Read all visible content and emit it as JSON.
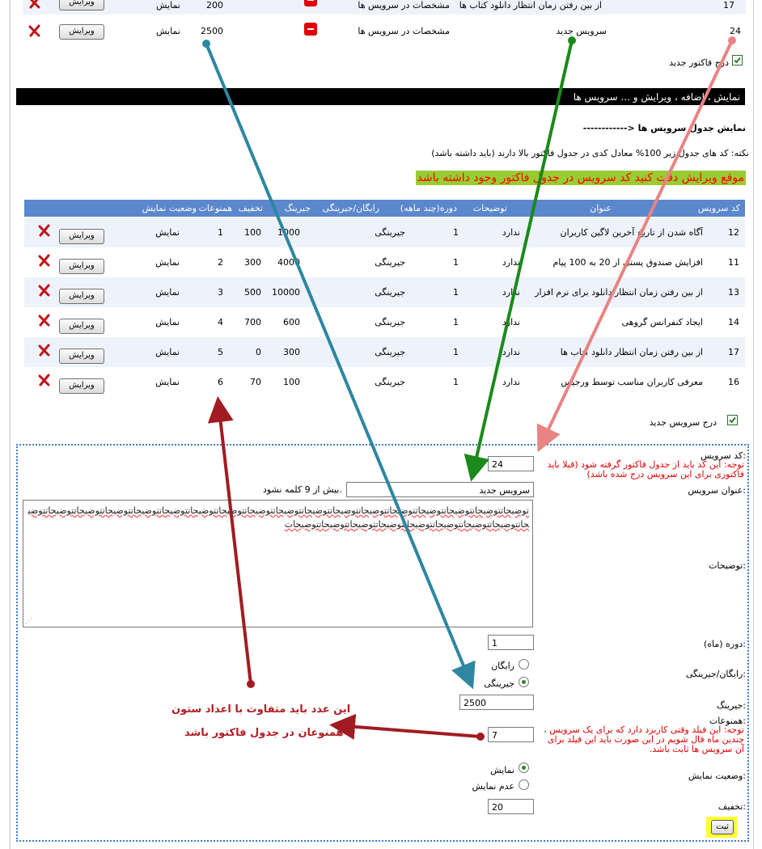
{
  "top_rows": [
    {
      "id": "17",
      "title": "از بین رفتن زمان انتظار دانلود کتاب ها",
      "spec": "مشخصات در سرویس ها",
      "price": "200",
      "status": "نمایش",
      "edit": "ویرایش"
    },
    {
      "id": "24",
      "title": "سرویس جدید",
      "spec": "مشخصات در سرویس ها",
      "price": "2500",
      "status": "نمایش",
      "edit": "ویرایش"
    }
  ],
  "insert_invoice_label": "درج فاکتور جدید",
  "section_bar_title": "نمایش ، اضافه ، ویرایش و ... سرویس ها",
  "services_table_link": "------------> نمایش جدول سرویس ها",
  "note": "نکته: کد های جدول زیر 100% معادل کدی در جدول فاکتور بالا دارند (باید داشته باشد)",
  "highlight_warning": "موقع ویرایش دقت کنید کد سرویس در جدول فاکتور وجود داشته باشد",
  "table": {
    "headers": [
      "کد سرویس",
      "عنوان",
      "توضیحات",
      "دوره(چند ماهه)",
      "رایگان/جیرینگی",
      "جیرینگ",
      "تخفیف",
      "همنوعات",
      "وضعیت نمایش"
    ],
    "rows": [
      {
        "code": "12",
        "title": "آگاه شدن از تاریخ آخرین لاگین کاربران",
        "desc": "ندارد",
        "period": "1",
        "type": "جیرینگی",
        "price": "1000",
        "discount": "100",
        "siblings": "1",
        "status": "نمایش",
        "edit": "ویرایش"
      },
      {
        "code": "11",
        "title": "افزایش صندوق پستی از 20 به 100 پیام",
        "desc": "ندارد",
        "period": "1",
        "type": "جیرینگی",
        "price": "4000",
        "discount": "300",
        "siblings": "2",
        "status": "نمایش",
        "edit": "ویرایش"
      },
      {
        "code": "13",
        "title": "از بین رفتن زمان انتظار دانلود برای نرم افزار",
        "desc": "ندارد",
        "period": "1",
        "type": "جیرینگی",
        "price": "10000",
        "discount": "500",
        "siblings": "3",
        "status": "نمایش",
        "edit": "ویرایش"
      },
      {
        "code": "14",
        "title": "ایجاد کنفرانس گروهی",
        "desc": "ندارد",
        "period": "1",
        "type": "جیرینگی",
        "price": "600",
        "discount": "700",
        "siblings": "4",
        "status": "نمایش",
        "edit": "ویرایش"
      },
      {
        "code": "17",
        "title": "از بین رفتن زمان انتظار دانلود کتاب ها",
        "desc": "ندارد",
        "period": "1",
        "type": "جیرینگی",
        "price": "300",
        "discount": "0",
        "siblings": "5",
        "status": "نمایش",
        "edit": "ویرایش"
      },
      {
        "code": "16",
        "title": "معرفی کاربران مناسب توسط ورجیس",
        "desc": "ندارد",
        "period": "1",
        "type": "جیرینگی",
        "price": "100",
        "discount": "70",
        "siblings": "6",
        "status": "نمایش",
        "edit": "ویرایش"
      }
    ]
  },
  "insert_service_label": "درج سرویس جدید",
  "form": {
    "code_label": "کد سرویس:",
    "code_note": "توجه: این کد باید از جدول فاکتور گرفته شود (قبلا باید فاکتوری برای این سرویس درج شده باشد)",
    "code_value": "24",
    "title_label": "عنوان سرویس:",
    "title_value": "سرویس جدید",
    "title_hint": "بیش از 9 کلمه نشود.",
    "desc_label": "توضیحات:",
    "desc_value": "توضیحاتتوضیحاتتوضیحاتتوضیحاتتوضیحاتتوضیحاتتوضیحاتتوضیحاتتوضیحاتتوضیحاتتوضیحاتتوضیحاتتوضیحاتتوضیحاتتوضیحاتتوضیحاتتوضیحاتتوضیحاتتوضیحاتتوضیحاتتوضیحاتتوضیحاتتوضیحاتتوضیحاتتوضیحاتتوضیحات",
    "period_label": "دوره (ماه):",
    "period_value": "1",
    "type_label": "رایگان/جیرینگی:",
    "type_options": [
      "رایگان",
      "جیرینگی"
    ],
    "type_selected": "جیرینگی",
    "price_label": "جیرینگ:",
    "price_value": "2500",
    "siblings_label": "همنوعات:",
    "siblings_note": "توجه: این فیلد وقتی کاربرد دارد که برای یک سرویس ، چندین ماه فال شویم در این صورت باید این فیلد برای آن سرویس ها ثابت باشد.",
    "siblings_value": "7",
    "status_label": "وضعیت نمایش:",
    "status_options": [
      "نمایش",
      "عدم نمایش"
    ],
    "status_selected": "نمایش",
    "discount_label": "تخفیف:",
    "discount_value": "20",
    "submit_label": "ثبت"
  },
  "annotation": {
    "line1": "این عدد باید متفاوت با اعداد ستون",
    "line2": "همنوعان در جدول فاکتور باشد"
  },
  "colors": {
    "table_header": "#5b87cc",
    "row_alt": "#eef3fb",
    "highlight_bg": "#99cc33",
    "arrow_teal": "#2e86a0",
    "arrow_green": "#1a8a1a",
    "arrow_pink": "#e88484",
    "arrow_darkred": "#a01c22"
  }
}
